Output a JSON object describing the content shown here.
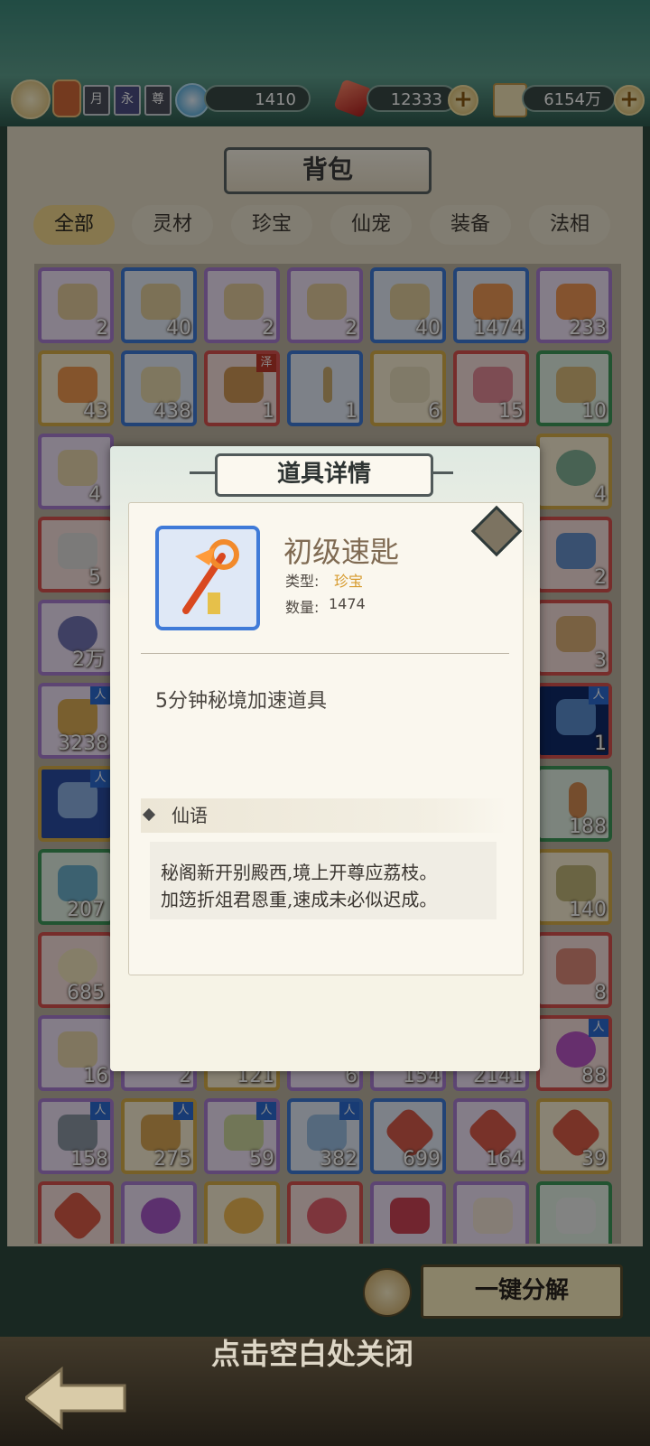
{
  "currencies": [
    {
      "name": "jade",
      "value": "1410",
      "icon": "swirl-gem-icon"
    },
    {
      "name": "spirit-crystal",
      "value": "12333",
      "icon": "red-crystal-icon"
    },
    {
      "name": "scroll-coin",
      "value": "6154万",
      "icon": "scroll-coin-icon"
    }
  ],
  "badges": [
    "月",
    "永",
    "尊"
  ],
  "bag": {
    "title": "背包",
    "tabs": [
      "全部",
      "灵材",
      "珍宝",
      "仙宠",
      "装备",
      "法相"
    ],
    "active_tab": "全部",
    "counts_row1": [
      "2",
      "40",
      "2",
      "2",
      "40",
      "1474",
      "233"
    ],
    "counts_row2": [
      "43",
      "438",
      "1",
      "1",
      "6",
      "15",
      "10"
    ],
    "left_col_counts": [
      "4",
      "5",
      "2万",
      "3238",
      "207",
      "685",
      "16"
    ],
    "right_col_counts": [
      "4",
      "2",
      "3",
      "1",
      "188",
      "140",
      "8",
      "88"
    ],
    "row12": [
      "158",
      "275",
      "59",
      "382",
      "699",
      "164",
      "39"
    ],
    "row11_partial": [
      "2",
      "121",
      "6",
      "154",
      "2141"
    ],
    "tag_ren": "人",
    "tag_ze": "泽",
    "decompose_label": "一键分解",
    "close_hint": "点击空白处关闭"
  },
  "modal": {
    "title": "道具详情",
    "item_name": "初级速匙",
    "type_label": "类型:",
    "type_value": "珍宝",
    "qty_label": "数量:",
    "qty_value": "1474",
    "description": "5分钟秘境加速道具",
    "lore_title": "仙语",
    "lore_line1": "秘阁新开别殿西,境上开尊应荔枝。",
    "lore_line2": "加笾折俎君恩重,速成未必似迟成。"
  },
  "colors": {
    "purple_border": "#aa7fd2",
    "blue_border": "#3f7ad8",
    "gold": "#f4d98f",
    "red_border": "#d9534f"
  }
}
